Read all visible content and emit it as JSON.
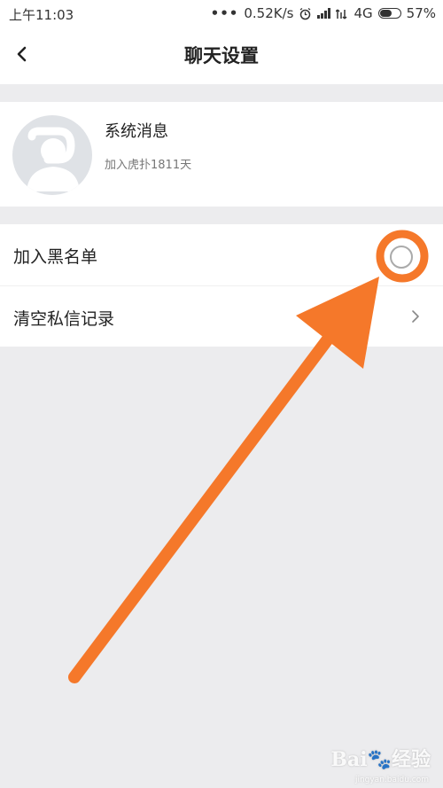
{
  "status_bar": {
    "time": "上午11:03",
    "dots": "•••",
    "speed": "0.52K/s",
    "network": "4G",
    "battery": "57%",
    "icons": [
      "alarm-icon",
      "signal-icon",
      "signal-icon",
      "battery-icon"
    ]
  },
  "nav": {
    "title": "聊天设置",
    "back_icon": "chevron-left-icon"
  },
  "profile": {
    "name": "系统消息",
    "subtitle": "加入虎扑1811天",
    "avatar_icon": "default-avatar-icon"
  },
  "settings": [
    {
      "label": "加入黑名单",
      "control": "toggle",
      "state": "off"
    },
    {
      "label": "清空私信记录",
      "control": "chevron-right-icon"
    }
  ],
  "annotation": {
    "color": "#f5782a",
    "shapes": [
      "highlight-circle",
      "pointer-arrow"
    ]
  },
  "watermark": {
    "brand": "Bai 经验",
    "url": "jingyan.baidu.com"
  }
}
